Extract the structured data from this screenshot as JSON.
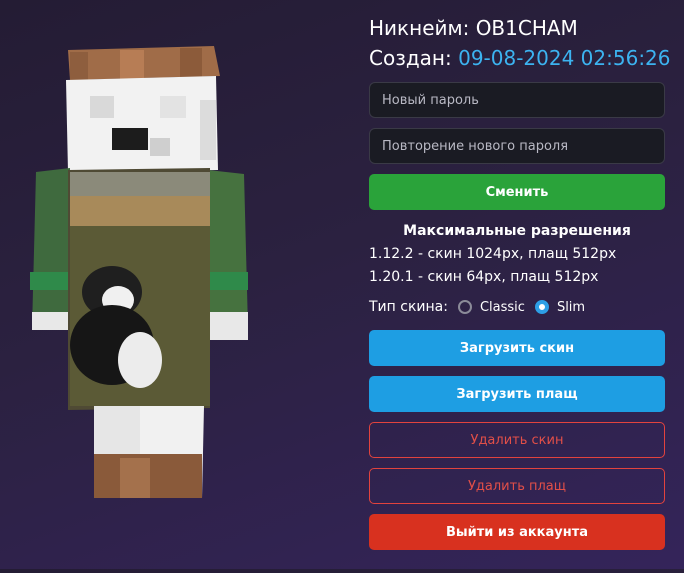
{
  "profile": {
    "nickname_label": "Никнейм:",
    "nickname_value": "OB1CHAM",
    "created_label": "Создан:",
    "created_value": "09-08-2024 02:56:26"
  },
  "password_form": {
    "new_password_placeholder": "Новый пароль",
    "repeat_password_placeholder": "Повторение нового пароля",
    "change_button": "Сменить"
  },
  "limits": {
    "title": "Максимальные разрешения",
    "line_1": "1.12.2 - скин 1024px, плащ 512px",
    "line_2": "1.20.1 - скин 64px, плащ 512px"
  },
  "skin_type": {
    "label": "Тип скина:",
    "options": [
      "Classic",
      "Slim"
    ],
    "selected": "Slim"
  },
  "actions": {
    "upload_skin": "Загрузить скин",
    "upload_cloak": "Загрузить плащ",
    "delete_skin": "Удалить скин",
    "delete_cloak": "Удалить плащ",
    "logout": "Выйти из аккаунта"
  },
  "colors": {
    "accent_blue": "#3cb3f0",
    "button_green": "#2aa33a",
    "button_blue": "#1e9ee3",
    "danger_red": "#d8311f"
  }
}
